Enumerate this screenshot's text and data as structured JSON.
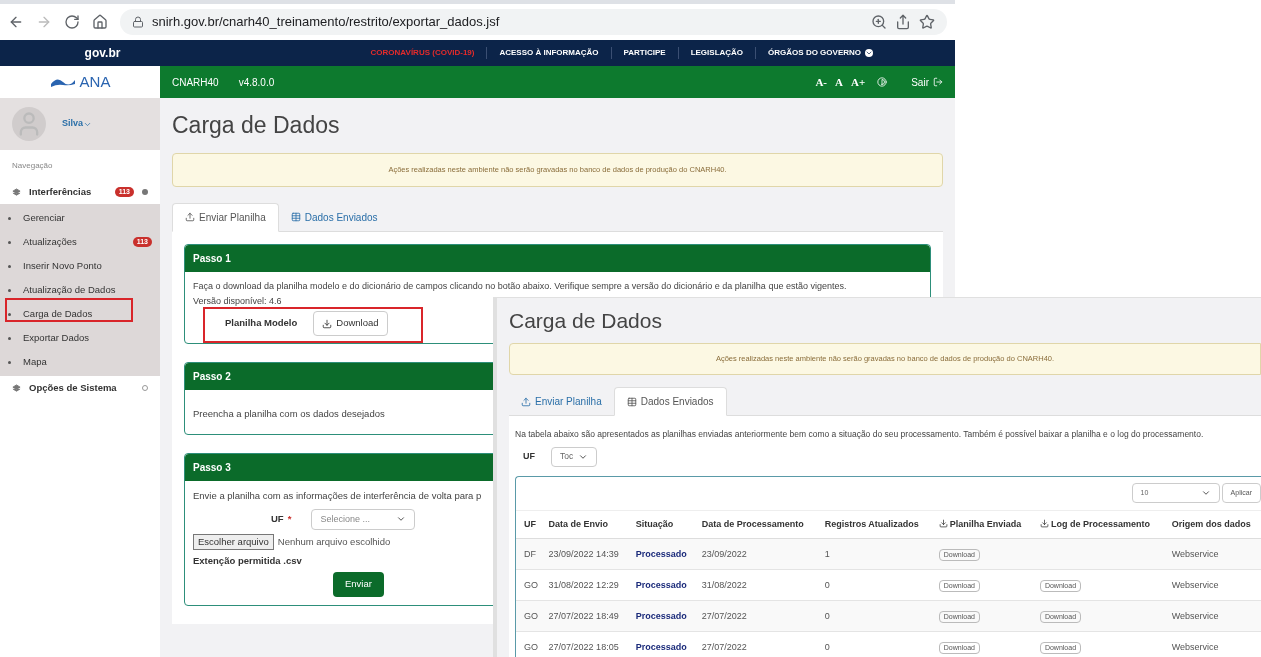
{
  "browser": {
    "url": "snirh.gov.br/cnarh40_treinamento/restrito/exportar_dados.jsf"
  },
  "govbar": {
    "logo": "gov.br",
    "links": [
      {
        "label": "CORONAVÍRUS (COVID-19)",
        "kind": "alert"
      },
      {
        "label": "ACESSO À INFORMAÇÃO",
        "kind": "plain"
      },
      {
        "label": "PARTICIPE",
        "kind": "plain"
      },
      {
        "label": "LEGISLAÇÃO",
        "kind": "plain"
      },
      {
        "label": "ÓRGÃOS DO GOVERNO",
        "kind": "dropdown"
      }
    ]
  },
  "app_header": {
    "logo": "ANA",
    "system": "CNARH40",
    "version": "v4.8.0.0",
    "font_controls": [
      "A-",
      "A",
      "A+"
    ],
    "logout": "Sair"
  },
  "sidebar": {
    "user": "Silva",
    "nav_label": "Navegação",
    "sections": [
      {
        "label": "Interferências",
        "badge": "113",
        "expanded": true,
        "children": [
          {
            "label": "Gerenciar"
          },
          {
            "label": "Atualizações",
            "badge": "113"
          },
          {
            "label": "Inserir Novo Ponto"
          },
          {
            "label": "Atualização de Dados"
          },
          {
            "label": "Carga de Dados"
          },
          {
            "label": "Exportar Dados"
          },
          {
            "label": "Mapa"
          }
        ]
      },
      {
        "label": "Opções de Sistema",
        "expanded": false
      }
    ]
  },
  "page": {
    "title": "Carga de Dados",
    "alert": "Ações realizadas neste ambiente não serão gravadas no banco de dados de produção do CNARH40.",
    "tabs": [
      {
        "label": "Enviar Planilha",
        "selected": true
      },
      {
        "label": "Dados Enviados",
        "selected": false
      }
    ],
    "step1": {
      "title": "Passo 1",
      "text": "Faça o download da planilha modelo e do dicionário de campos clicando no botão abaixo. Verifique sempre a versão do dicionário e da planilha que estão vigentes.",
      "version": "Versão disponível: 4.6",
      "label": "Planilha Modelo",
      "button": "Download"
    },
    "step2": {
      "title": "Passo 2",
      "text": "Preencha a planilha com os dados desejados"
    },
    "step3": {
      "title": "Passo 3",
      "text": "Envie a planilha com as informações de interferência de volta para p",
      "uf_label": "UF",
      "uf_required": "*",
      "uf_placeholder": "Selecione ...",
      "file_button": "Escolher arquivo",
      "file_status": "Nenhum arquivo escolhido",
      "extension": "Extenção permitida .csv",
      "submit": "Enviar"
    }
  },
  "overlay": {
    "title": "Carga de Dados",
    "alert": "Ações realizadas neste ambiente não serão gravadas no banco de dados de produção do CNARH40.",
    "tabs": [
      {
        "label": "Enviar Planilha",
        "selected": false
      },
      {
        "label": "Dados Enviados",
        "selected": true
      }
    ],
    "description": "Na tabela abaixo são apresentados as planilhas enviadas anteriormente bem como a situação do seu processamento. Também é possível baixar a planilha e o log do processamento.",
    "uf_label": "UF",
    "uf_value": "Toc",
    "page_size": "10",
    "apply": "Aplicar",
    "table": {
      "columns": [
        {
          "label": "UF"
        },
        {
          "label": "Data de Envio"
        },
        {
          "label": "Situação"
        },
        {
          "label": "Data de Processamento"
        },
        {
          "label": "Registros Atualizados"
        },
        {
          "label": "Planilha Enviada",
          "kind": "file"
        },
        {
          "label": "Log de Processamento",
          "kind": "file"
        },
        {
          "label": "Origem dos dados"
        }
      ],
      "rows": [
        {
          "uf": "DF",
          "sent": "23/09/2022 14:39",
          "status": "Processado",
          "processed": "23/09/2022",
          "records": "1",
          "sheet": "Download",
          "origin": "Webservice"
        },
        {
          "uf": "GO",
          "sent": "31/08/2022 12:29",
          "status": "Processado",
          "processed": "31/08/2022",
          "records": "0",
          "sheet": "Download",
          "log": "Download",
          "origin": "Webservice"
        },
        {
          "uf": "GO",
          "sent": "27/07/2022 18:49",
          "status": "Processado",
          "processed": "27/07/2022",
          "records": "0",
          "sheet": "Download",
          "log": "Download",
          "origin": "Webservice"
        },
        {
          "uf": "GO",
          "sent": "27/07/2022 18:05",
          "status": "Processado",
          "processed": "27/07/2022",
          "records": "0",
          "sheet": "Download",
          "log": "Download",
          "origin": "Webservice"
        }
      ]
    }
  }
}
